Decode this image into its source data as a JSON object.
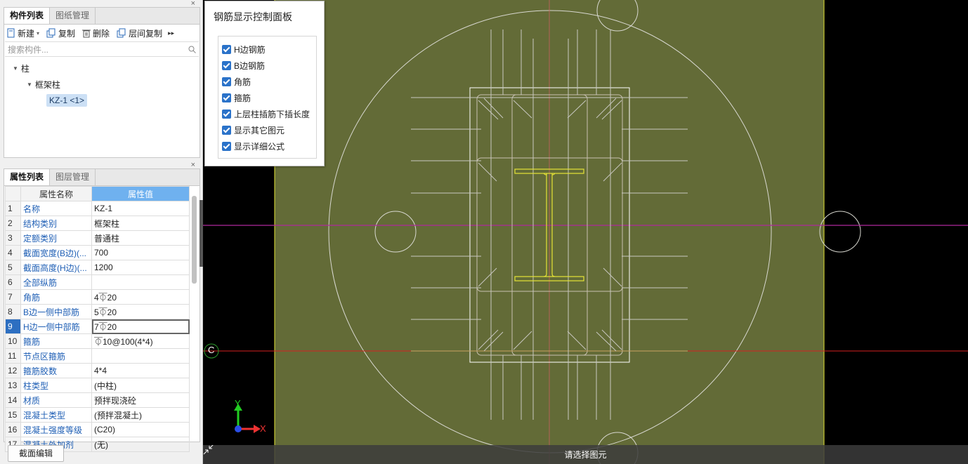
{
  "component_panel": {
    "tabs": [
      "构件列表",
      "图纸管理"
    ],
    "close": "×",
    "toolbar": {
      "new": "新建",
      "copy": "复制",
      "delete": "删除",
      "floor_copy": "层间复制",
      "more": "▸▸"
    },
    "search_placeholder": "搜索构件...",
    "tree": {
      "root": "柱",
      "child": "框架柱",
      "leaf": "KZ-1 <1>"
    }
  },
  "property_panel": {
    "tabs": [
      "属性列表",
      "图层管理"
    ],
    "close": "×",
    "headers": [
      "属性名称",
      "属性值"
    ],
    "rows": [
      {
        "n": "1",
        "name": "名称",
        "value": "KZ-1"
      },
      {
        "n": "2",
        "name": "结构类别",
        "value": "框架柱"
      },
      {
        "n": "3",
        "name": "定额类别",
        "value": "普通柱"
      },
      {
        "n": "4",
        "name": "截面宽度(B边)(...",
        "value": "700"
      },
      {
        "n": "5",
        "name": "截面高度(H边)(...",
        "value": "1200"
      },
      {
        "n": "6",
        "name": "全部纵筋",
        "value": ""
      },
      {
        "n": "7",
        "name": "角筋",
        "value": "4⏁20"
      },
      {
        "n": "8",
        "name": "B边一侧中部筋",
        "value": "5⏁20"
      },
      {
        "n": "9",
        "name": "H边一侧中部筋",
        "value": "7⏁20"
      },
      {
        "n": "10",
        "name": "箍筋",
        "value": "⏁10@100(4*4)"
      },
      {
        "n": "11",
        "name": "节点区箍筋",
        "value": ""
      },
      {
        "n": "12",
        "name": "箍筋胶数",
        "value": "4*4"
      },
      {
        "n": "13",
        "name": "柱类型",
        "value": "(中柱)"
      },
      {
        "n": "14",
        "name": "材质",
        "value": "预拌现浇砼"
      },
      {
        "n": "15",
        "name": "混凝土类型",
        "value": "(预拌混凝土)"
      },
      {
        "n": "16",
        "name": "混凝土强度等级",
        "value": "(C20)"
      },
      {
        "n": "17",
        "name": "混凝土外加剂",
        "value": "(无)"
      }
    ],
    "selected_row": 9,
    "section_edit_button": "截面编辑"
  },
  "rebar_panel": {
    "title": "钢筋显示控制面板",
    "options": [
      {
        "label": "H边钢筋",
        "checked": true
      },
      {
        "label": "B边钢筋",
        "checked": true
      },
      {
        "label": "角筋",
        "checked": true
      },
      {
        "label": "箍筋",
        "checked": true
      },
      {
        "label": "上层柱插筋下插长度",
        "checked": true
      },
      {
        "label": "显示其它图元",
        "checked": true
      },
      {
        "label": "显示详细公式",
        "checked": true
      }
    ]
  },
  "canvas": {
    "axis_label": "C",
    "ucs_y": "Y",
    "ucs_x": "X",
    "status": "请选择图元",
    "colors": {
      "background": "#000000",
      "slab": "#636b37",
      "grid_magenta": "#b0289c",
      "grid_red": "#d42020",
      "steel": "#e5e336",
      "lines": "#d8d8d0"
    }
  }
}
